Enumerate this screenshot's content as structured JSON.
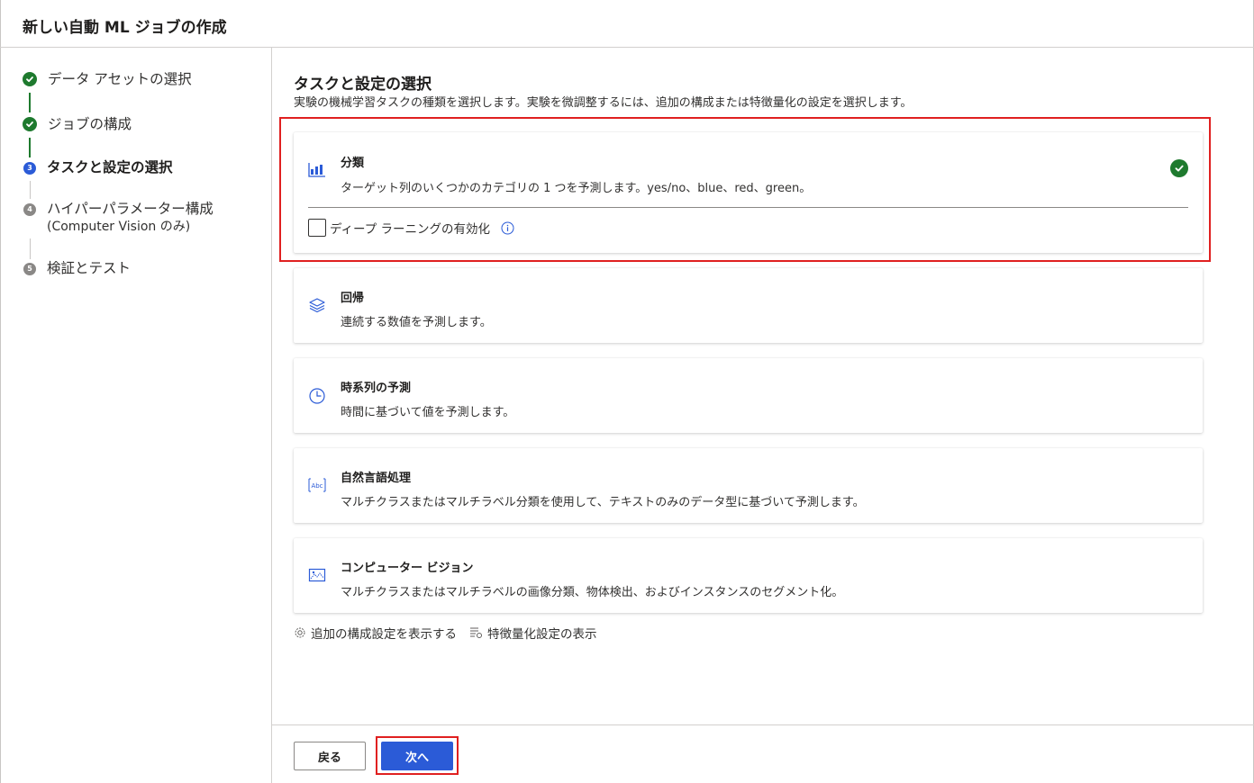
{
  "header": {
    "title": "新しい自動 ML ジョブの作成"
  },
  "sidebar": {
    "steps": [
      {
        "number": "1",
        "label": "データ アセットの選択",
        "state": "done"
      },
      {
        "number": "2",
        "label": "ジョブの構成",
        "state": "done"
      },
      {
        "number": "3",
        "label": "タスクと設定の選択",
        "state": "current"
      },
      {
        "number": "4",
        "label": "ハイパーパラメーター構成",
        "sublabel": "(Computer Vision のみ)",
        "state": "pending"
      },
      {
        "number": "5",
        "label": "検証とテスト",
        "state": "pending"
      }
    ]
  },
  "main": {
    "title": "タスクと設定の選択",
    "description": "実験の機械学習タスクの種類を選択します。実験を微調整するには、追加の構成または特徴量化の設定を選択します。",
    "tasks": [
      {
        "name": "分類",
        "description": "ターゲット列のいくつかのカテゴリの 1 つを予測します。yes/no、blue、red、green。",
        "icon": "bar-chart-icon",
        "selected": true
      },
      {
        "name": "回帰",
        "description": "連続する数値を予測します。",
        "icon": "layers-icon",
        "selected": false
      },
      {
        "name": "時系列の予測",
        "description": "時間に基づいて値を予測します。",
        "icon": "clock-icon",
        "selected": false
      },
      {
        "name": "自然言語処理",
        "description": "マルチクラスまたはマルチラベル分類を使用して、テキストのみのデータ型に基づいて予測します。",
        "icon": "text-abc-icon",
        "selected": false
      },
      {
        "name": "コンピューター ビジョン",
        "description": "マルチクラスまたはマルチラベルの画像分類、物体検出、およびインスタンスのセグメント化。",
        "icon": "image-icon",
        "selected": false
      }
    ],
    "deep_learning": {
      "label": "ディープ ラーニングの有効化",
      "checked": false
    },
    "links": {
      "additional_config": "追加の構成設定を表示する",
      "featurization": "特徴量化設定の表示"
    }
  },
  "footer": {
    "back_label": "戻る",
    "next_label": "次へ"
  },
  "colors": {
    "accent": "#2b5bd7",
    "success": "#1e7a2e",
    "highlight": "#e02020"
  }
}
